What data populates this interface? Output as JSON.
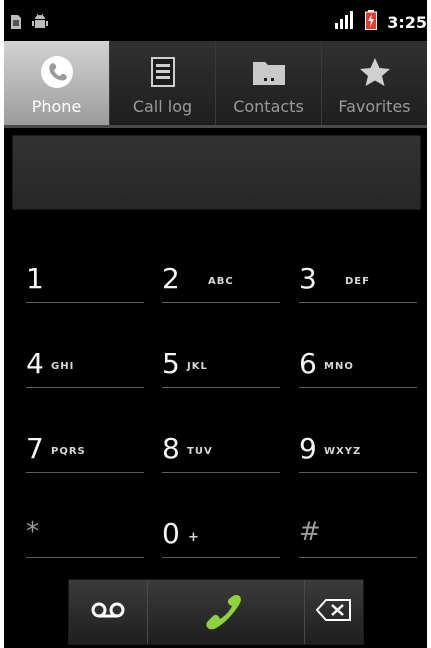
{
  "status_bar": {
    "time": "3:25",
    "icons": [
      "sim-card-icon",
      "android-debug-icon",
      "signal-icon",
      "battery-charging-icon"
    ]
  },
  "tabs": [
    {
      "label": "Phone",
      "icon": "phone-handset-icon",
      "active": true
    },
    {
      "label": "Call log",
      "icon": "list-icon",
      "active": false
    },
    {
      "label": "Contacts",
      "icon": "folder-icon",
      "active": false
    },
    {
      "label": "Favorites",
      "icon": "star-icon",
      "active": false
    }
  ],
  "number_display": {
    "value": ""
  },
  "keypad": [
    {
      "digit": "1",
      "letters": ""
    },
    {
      "digit": "2",
      "letters": "ABC"
    },
    {
      "digit": "3",
      "letters": "DEF"
    },
    {
      "digit": "4",
      "letters": "GHI"
    },
    {
      "digit": "5",
      "letters": "JKL"
    },
    {
      "digit": "6",
      "letters": "MNO"
    },
    {
      "digit": "7",
      "letters": "PQRS"
    },
    {
      "digit": "8",
      "letters": "TUV"
    },
    {
      "digit": "9",
      "letters": "WXYZ"
    },
    {
      "digit": "*",
      "letters": ""
    },
    {
      "digit": "0",
      "letters": "+"
    },
    {
      "digit": "#",
      "letters": ""
    }
  ],
  "action_bar": {
    "voicemail_icon": "voicemail-icon",
    "dial_icon": "phone-handset-icon",
    "delete_icon": "backspace-icon"
  },
  "colors": {
    "dial_green": "#8ed33b",
    "active_tab": "#b8b8b8",
    "background": "#000000"
  }
}
